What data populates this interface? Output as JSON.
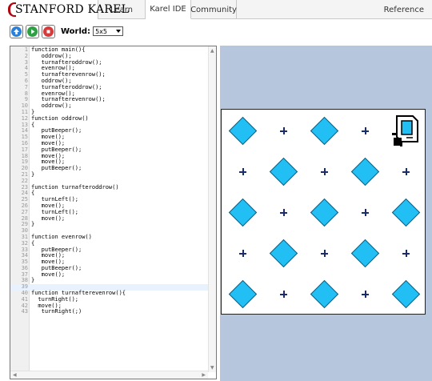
{
  "nav": {
    "brand": "STANFORD KAREL",
    "tabs": [
      {
        "label": "Learn"
      },
      {
        "label": "Karel IDE"
      },
      {
        "label": "Community"
      }
    ],
    "reference": "Reference"
  },
  "toolbar": {
    "world_label": "World:",
    "world_value": "5x5",
    "buttons": [
      "up-icon",
      "play-icon",
      "stop-icon"
    ]
  },
  "editor": {
    "active_line": 39,
    "lines": [
      {
        "n": "1",
        "text": "function main(){"
      },
      {
        "n": "2",
        "text": "   oddrow();"
      },
      {
        "n": "3",
        "text": "   turnafteroddrow();"
      },
      {
        "n": "4",
        "text": "   evenrow();"
      },
      {
        "n": "5",
        "text": "   turnafterevenrow();"
      },
      {
        "n": "6",
        "text": "   oddrow();"
      },
      {
        "n": "7",
        "text": "   turnafteroddrow();"
      },
      {
        "n": "8",
        "text": "   evenrow();"
      },
      {
        "n": "9",
        "text": "   turnafterevenrow();"
      },
      {
        "n": "10",
        "text": "   oddrow();"
      },
      {
        "n": "11",
        "text": "}"
      },
      {
        "n": "12",
        "text": "function oddrow()"
      },
      {
        "n": "13",
        "text": "{"
      },
      {
        "n": "14",
        "text": "   putBeeper();"
      },
      {
        "n": "15",
        "text": "   move();"
      },
      {
        "n": "16",
        "text": "   move();"
      },
      {
        "n": "17",
        "text": "   putBeeper();"
      },
      {
        "n": "18",
        "text": "   move();"
      },
      {
        "n": "19",
        "text": "   move();"
      },
      {
        "n": "20",
        "text": "   putBeeper();"
      },
      {
        "n": "21",
        "text": "}"
      },
      {
        "n": "22",
        "text": ""
      },
      {
        "n": "23",
        "text": "function turnafteroddrow()"
      },
      {
        "n": "24",
        "text": "{"
      },
      {
        "n": "25",
        "text": "   turnLeft();"
      },
      {
        "n": "26",
        "text": "   move();"
      },
      {
        "n": "27",
        "text": "   turnLeft();"
      },
      {
        "n": "28",
        "text": "   move();"
      },
      {
        "n": "29",
        "text": "}"
      },
      {
        "n": "30",
        "text": ""
      },
      {
        "n": "31",
        "text": "function evenrow()"
      },
      {
        "n": "32",
        "text": "{"
      },
      {
        "n": "33",
        "text": "   putBeeper();"
      },
      {
        "n": "34",
        "text": "   move();"
      },
      {
        "n": "35",
        "text": "   move();"
      },
      {
        "n": "36",
        "text": "   putBeeper();"
      },
      {
        "n": "37",
        "text": "   move();"
      },
      {
        "n": "38",
        "text": "}"
      },
      {
        "n": "39",
        "text": ""
      },
      {
        "n": "40",
        "text": "function turnafterevenrow(){"
      },
      {
        "n": "41",
        "text": "  turnRight();"
      },
      {
        "n": "42",
        "text": "  move();"
      },
      {
        "n": "43",
        "text": "   turnRight(;)"
      }
    ]
  },
  "world": {
    "rows": 5,
    "cols": 5,
    "grid": [
      [
        "beeper",
        "corner",
        "beeper",
        "corner",
        "karel"
      ],
      [
        "corner",
        "beeper",
        "corner",
        "beeper",
        "corner"
      ],
      [
        "beeper",
        "corner",
        "beeper",
        "corner",
        "beeper"
      ],
      [
        "corner",
        "beeper",
        "corner",
        "beeper",
        "corner"
      ],
      [
        "beeper",
        "corner",
        "beeper",
        "corner",
        "beeper"
      ]
    ],
    "karel_facing": "east",
    "colors": {
      "beeper": "#22bff5",
      "corner": "#1a2d6b",
      "background": "#b5c6dd",
      "brand": "#b1040e"
    }
  }
}
